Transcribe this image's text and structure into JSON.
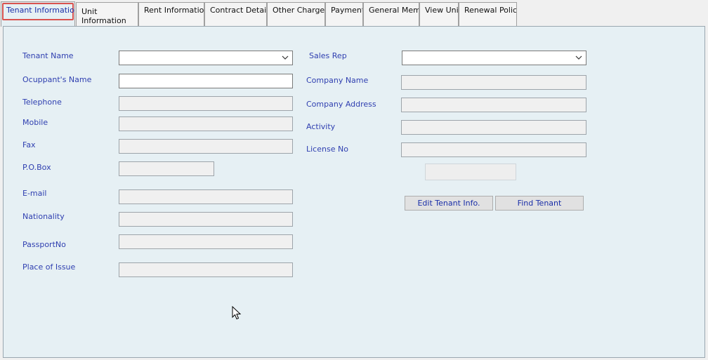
{
  "tabs": [
    {
      "label": "Tenant Informatior"
    },
    {
      "label": "Unit Information"
    },
    {
      "label": "Rent Informatior"
    },
    {
      "label": "Contract Details"
    },
    {
      "label": "Other Charges"
    },
    {
      "label": "Payment:"
    },
    {
      "label": "General Memo"
    },
    {
      "label": "View Unit"
    },
    {
      "label": "Renewal Policy"
    }
  ],
  "form": {
    "tenant_name": {
      "label": "Tenant Name",
      "value": ""
    },
    "occupant_name": {
      "label": "Ocuppant's Name",
      "value": ""
    },
    "telephone": {
      "label": "Telephone",
      "value": ""
    },
    "mobile": {
      "label": "Mobile",
      "value": ""
    },
    "fax": {
      "label": "Fax",
      "value": ""
    },
    "po_box": {
      "label": "P.O.Box",
      "value": ""
    },
    "email": {
      "label": "E-mail",
      "value": ""
    },
    "nationality": {
      "label": "Nationality",
      "value": ""
    },
    "passport_no": {
      "label": "PassportNo",
      "value": ""
    },
    "place_of_issue": {
      "label": "Place of Issue",
      "value": ""
    },
    "sales_rep": {
      "label": "Sales Rep",
      "value": ""
    },
    "company_name": {
      "label": "Company Name",
      "value": ""
    },
    "company_address": {
      "label": "Company Address",
      "value": ""
    },
    "activity": {
      "label": "Activity",
      "value": ""
    },
    "license_no": {
      "label": "License No",
      "value": ""
    }
  },
  "buttons": {
    "edit_tenant": "Edit Tenant Info.",
    "find_tenant": "Find Tenant"
  },
  "icons": {
    "combo_arrow": "chevron-down-icon",
    "cursor": "mouse-pointer-icon"
  },
  "colors": {
    "panel_bg": "#e6f0f4",
    "label_text": "#2f3fb0",
    "active_tab_focus": "#d9534f"
  }
}
